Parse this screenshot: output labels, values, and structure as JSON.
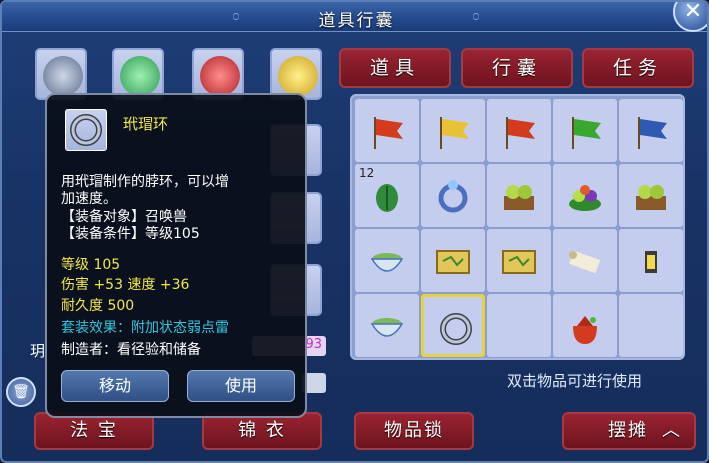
{
  "window": {
    "title": "道具行囊",
    "close_label": "✕"
  },
  "tabs": [
    {
      "label": "道具"
    },
    {
      "label": "行囊"
    },
    {
      "label": "任务"
    }
  ],
  "grid": {
    "rows": [
      [
        {
          "icon": "red-flag-icon",
          "qty": ""
        },
        {
          "icon": "yellow-flag-icon",
          "qty": ""
        },
        {
          "icon": "red-flag-icon",
          "qty": ""
        },
        {
          "icon": "green-flag-icon",
          "qty": ""
        },
        {
          "icon": "blue-flag-icon",
          "qty": ""
        }
      ],
      [
        {
          "icon": "leaf-icon",
          "qty": "12"
        },
        {
          "icon": "gem-ring-icon",
          "qty": ""
        },
        {
          "icon": "fruit-box-icon",
          "qty": ""
        },
        {
          "icon": "fruit-plate-icon",
          "qty": ""
        },
        {
          "icon": "fruit-box-icon",
          "qty": ""
        }
      ],
      [
        {
          "icon": "tea-bowl-icon",
          "qty": ""
        },
        {
          "icon": "treasure-map-icon",
          "qty": ""
        },
        {
          "icon": "treasure-map-icon",
          "qty": ""
        },
        {
          "icon": "scroll-icon",
          "qty": ""
        },
        {
          "icon": "lantern-icon",
          "qty": ""
        }
      ],
      [
        {
          "icon": "tea-bowl-icon",
          "qty": ""
        },
        {
          "icon": "silver-ring-icon",
          "qty": ""
        },
        {
          "icon": "",
          "qty": ""
        },
        {
          "icon": "red-pouch-icon",
          "qty": ""
        },
        {
          "icon": "",
          "qty": ""
        }
      ]
    ],
    "selected": {
      "row": 3,
      "col": 1
    }
  },
  "hint": "双击物品可进行使用",
  "bottom_buttons": [
    {
      "label": "法 宝"
    },
    {
      "label": "锦 衣"
    },
    {
      "label": "物品锁"
    },
    {
      "label": "摆摊"
    }
  ],
  "expand_icon": "chevron-up-icon",
  "trash_icon": "trash-icon",
  "tooltip": {
    "name": "玳瑁环",
    "desc_1": "用玳瑁制作的脖环，可以增",
    "desc_2": "加速度。",
    "target": "【装备对象】召唤兽",
    "condition": "【装备条件】等级105",
    "level": "等级 105",
    "stats": "伤害 +53 速度 +36",
    "durability": "耐久度 500",
    "set_effect": "套装效果：附加状态弱点雷",
    "maker": "制造者：看径验和储备",
    "move_label": "移动",
    "use_label": "使用"
  },
  "partial_text": {
    "left_char": "玥",
    "right_num": "93"
  },
  "colors": {
    "tab_red": "#8a1c28",
    "grid_cell": "#c5cdee",
    "selected_border": "#e8d23a",
    "tooltip_yellow": "#f2e84a",
    "tooltip_cyan": "#31c7df"
  }
}
